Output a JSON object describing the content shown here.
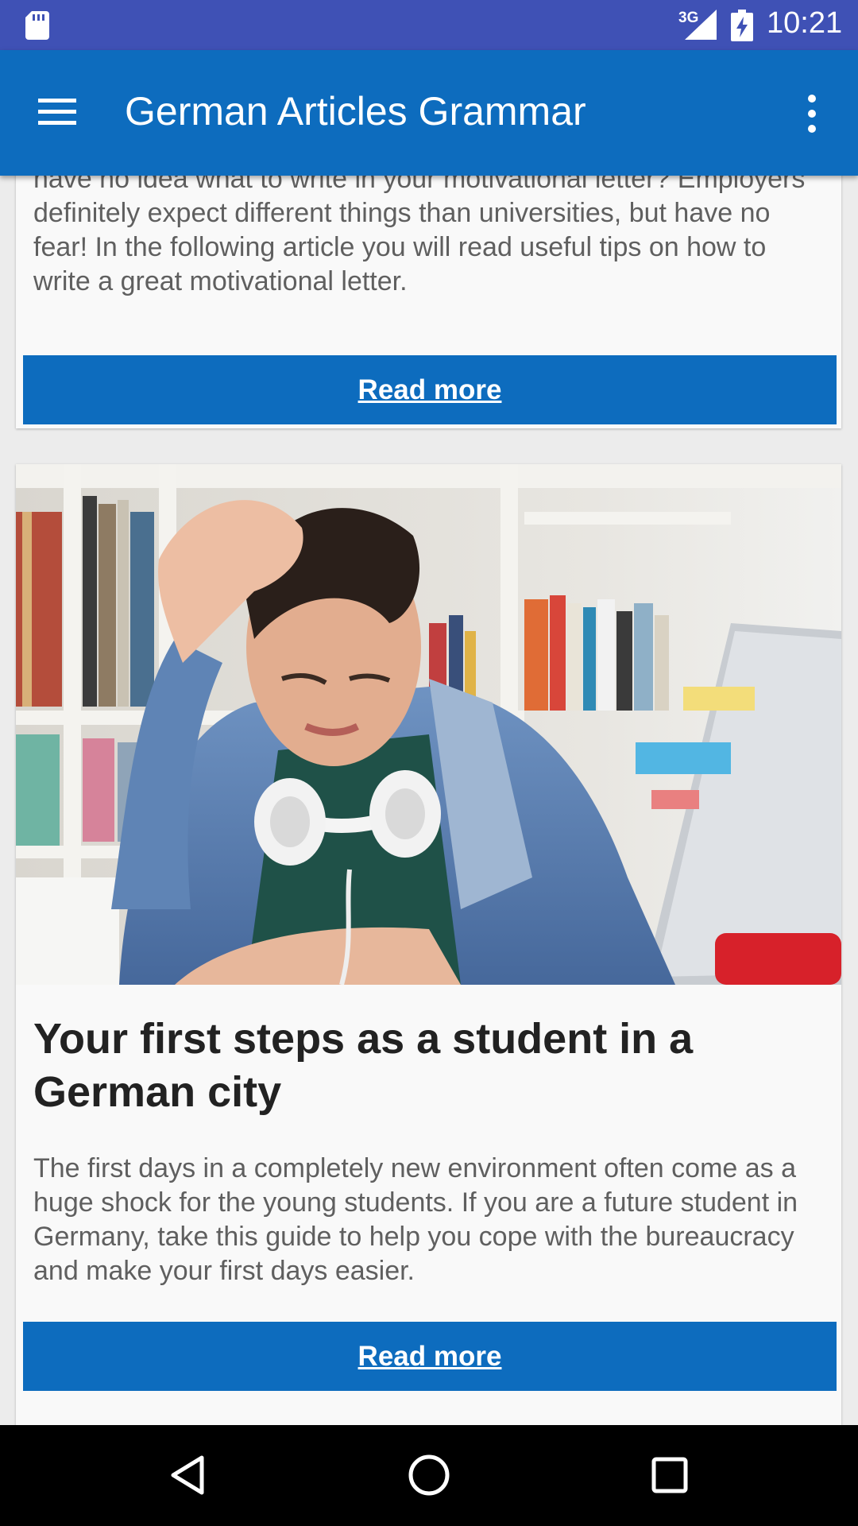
{
  "status_bar": {
    "network": "3G",
    "time": "10:21",
    "icons": [
      "sd-card-icon",
      "signal-icon",
      "battery-charging-icon"
    ]
  },
  "app_bar": {
    "title": "German Articles Grammar",
    "menu_icon": "hamburger-menu-icon",
    "overflow_icon": "more-vert-icon",
    "color": "#0d6cbe"
  },
  "articles": [
    {
      "excerpt": "come that time, when you have to apply for a student job, but have no idea what to write in your motivational letter? Employers definitely expect different things than universities, but have no fear! In the following article you will read useful tips on how to write a great  motivational letter.",
      "read_more": "Read more"
    },
    {
      "image": "photo of a tired student holding his head, wearing headphones, in front of a laptop and bookshelves",
      "title": "Your first steps as a student in a German city",
      "excerpt": "The first days in a completely new environment often come as a huge shock for the young students. If you are a future student in Germany, take this guide to help you cope with the bureaucracy and make your first days easier.",
      "read_more": "Read more"
    }
  ],
  "nav_bar": {
    "icons": [
      "back-icon",
      "home-icon",
      "recents-icon"
    ]
  },
  "colors": {
    "status_bar": "#3f51b5",
    "primary": "#0d6cbe",
    "card_bg": "#f9f9f9"
  }
}
